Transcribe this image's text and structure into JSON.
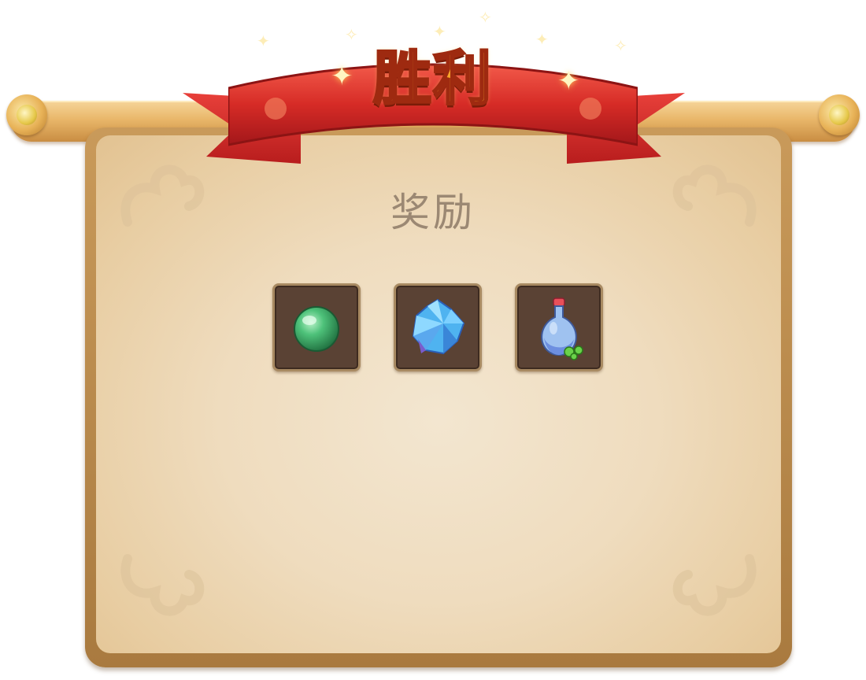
{
  "banner": {
    "title": "胜利",
    "ribbon_color": "#d62b26",
    "title_color": "#f6a52a"
  },
  "panel": {
    "heading": "奖励",
    "background_color": "#efdcbe"
  },
  "rewards": {
    "items": [
      {
        "icon": "green-orb-icon"
      },
      {
        "icon": "blue-crystal-icon"
      },
      {
        "icon": "potion-bottle-icon"
      }
    ]
  }
}
